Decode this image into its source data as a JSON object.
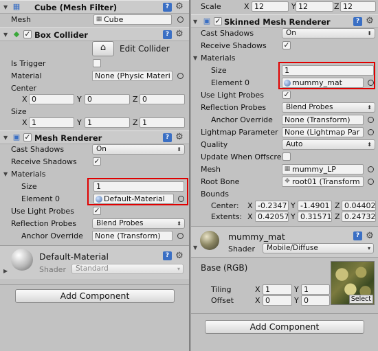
{
  "left": {
    "mesh_filter": {
      "title": "Cube (Mesh Filter)",
      "mesh_label": "Mesh",
      "mesh_value": "Cube"
    },
    "box_collider": {
      "title": "Box Collider",
      "edit_collider_label": "Edit Collider",
      "is_trigger_label": "Is Trigger",
      "material_label": "Material",
      "material_value": "None (Physic Materi",
      "center_label": "Center",
      "center": {
        "x": "0",
        "y": "0",
        "z": "0"
      },
      "size_label": "Size",
      "size": {
        "x": "1",
        "y": "1",
        "z": "1"
      }
    },
    "mesh_renderer": {
      "title": "Mesh Renderer",
      "cast_shadows_label": "Cast Shadows",
      "cast_shadows_value": "On",
      "receive_shadows_label": "Receive Shadows",
      "materials_label": "Materials",
      "size_label": "Size",
      "size_value": "1",
      "element0_label": "Element 0",
      "element0_value": "Default-Material",
      "use_light_probes_label": "Use Light Probes",
      "reflection_probes_label": "Reflection Probes",
      "reflection_probes_value": "Blend Probes",
      "anchor_override_label": "Anchor Override",
      "anchor_override_value": "None (Transform)"
    },
    "material": {
      "name": "Default-Material",
      "shader_label": "Shader",
      "shader_value": "Standard"
    },
    "add_component_label": "Add Component"
  },
  "right": {
    "scale": {
      "label": "Scale",
      "x": "12",
      "y": "12",
      "z": "12"
    },
    "skinned": {
      "title": "Skinned Mesh Renderer",
      "cast_shadows_label": "Cast Shadows",
      "cast_shadows_value": "On",
      "receive_shadows_label": "Receive Shadows",
      "materials_label": "Materials",
      "size_label": "Size",
      "size_value": "1",
      "element0_label": "Element 0",
      "element0_value": "mummy_mat",
      "use_light_probes_label": "Use Light Probes",
      "reflection_probes_label": "Reflection Probes",
      "reflection_probes_value": "Blend Probes",
      "anchor_override_label": "Anchor Override",
      "anchor_override_value": "None (Transform)",
      "lightmap_label": "Lightmap Parameter",
      "lightmap_value": "None (Lightmap Par",
      "quality_label": "Quality",
      "quality_value": "Auto",
      "update_offscreen_label": "Update When Offscre",
      "mesh_label": "Mesh",
      "mesh_value": "mummy_LP",
      "root_bone_label": "Root Bone",
      "root_bone_value": "root01 (Transform",
      "bounds_label": "Bounds",
      "center_label": "Center:",
      "center": {
        "x": "-0.2347",
        "y": "-1.4901",
        "z": "0.04402"
      },
      "extents_label": "Extents:",
      "extents": {
        "x": "0.42057",
        "y": "0.31571",
        "z": "0.24732"
      }
    },
    "material": {
      "name": "mummy_mat",
      "shader_label": "Shader",
      "shader_value": "Mobile/Diffuse",
      "base_label": "Base (RGB)",
      "tiling_label": "Tiling",
      "tiling": {
        "x": "1",
        "y": "1"
      },
      "offset_label": "Offset",
      "offset": {
        "x": "0",
        "y": "0"
      },
      "select_label": "Select"
    },
    "add_component_label": "Add Component"
  },
  "axis": {
    "x": "X",
    "y": "Y",
    "z": "Z"
  }
}
